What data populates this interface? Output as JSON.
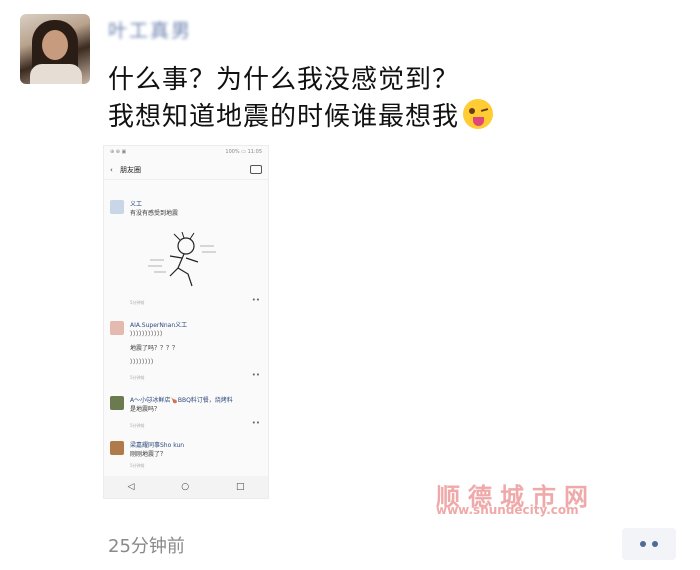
{
  "post": {
    "username": "叶工真男",
    "line1": "什么事？为什么我没感觉到？",
    "line2": "我想知道地震的时候谁最想我",
    "emoji": "wink-tongue-emoji",
    "time": "25分钟前"
  },
  "screenshot": {
    "status_left": "⊕ ⊕ ▣",
    "status_right": "100% ▭ 11:05",
    "title": "朋友圈",
    "posts": [
      {
        "name": "义工",
        "text": "有没有感受到地震",
        "time": "5分钟前"
      },
      {
        "name": "AIA.SuperNnan义工",
        "text": "）））））））））））",
        "text2": "地震了吗？？？？",
        "text3": "））））））））",
        "time": "5分钟前"
      },
      {
        "name": "A～小🐱冰鲜店🍗BBQ料订餐，烧烤料",
        "text": "是地震吗？",
        "time": "5分钟前"
      },
      {
        "name": "梁嘉耀同事Sho kun",
        "text": "刚刚地震了？",
        "time": "5分钟前"
      }
    ],
    "nav": [
      "◁",
      "○",
      "□"
    ]
  },
  "watermark": {
    "name": "顺德城市网",
    "url": "www.shundecity.com"
  }
}
